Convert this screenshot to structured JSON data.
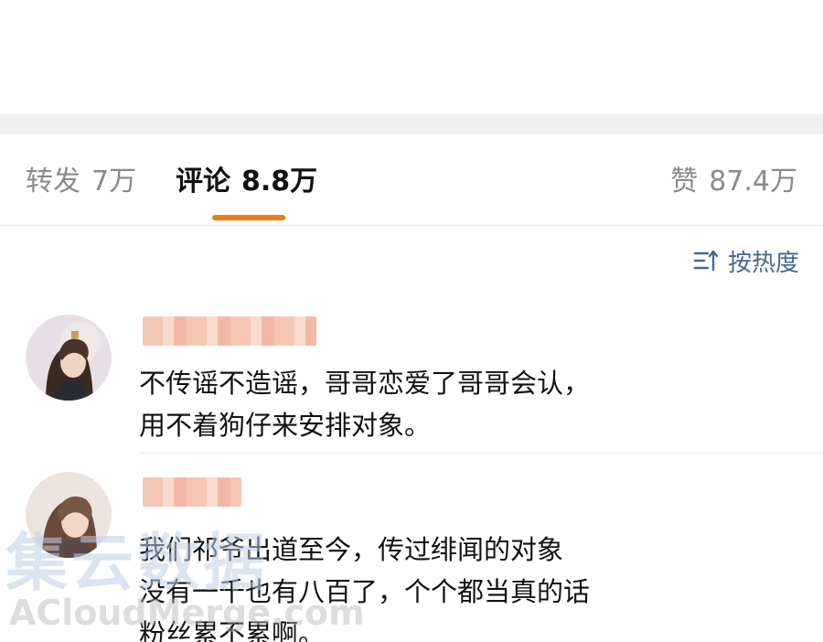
{
  "tabs": {
    "repost": {
      "label": "转发",
      "count": "7万"
    },
    "comments": {
      "label": "评论",
      "count": "8.8万"
    },
    "likes": {
      "label": "赞",
      "count": "87.4万"
    }
  },
  "sort": {
    "label": "按热度",
    "icon": "sort-icon"
  },
  "comments": [
    {
      "avatar_icon": "avatar-illustrated-character",
      "lines": [
        "不传谣不造谣，哥哥恋爱了哥哥会认，",
        "用不着狗仔来安排对象。"
      ]
    },
    {
      "avatar_icon": "avatar-illustrated-character",
      "lines": [
        "我们祁爷出道至今，传过绯闻的对象",
        "没有一千也有八百了，个个都当真的话",
        "粉丝累不累啊。"
      ]
    }
  ],
  "watermark": {
    "cn": "集云数据",
    "en": "ACloudMerge.com"
  },
  "colors": {
    "accent": "#f07a12",
    "sort_text": "#47688f",
    "tab_inactive": "#8a8a8a",
    "divider": "#f0f0f0",
    "blur_name": "#f6c6b5"
  }
}
